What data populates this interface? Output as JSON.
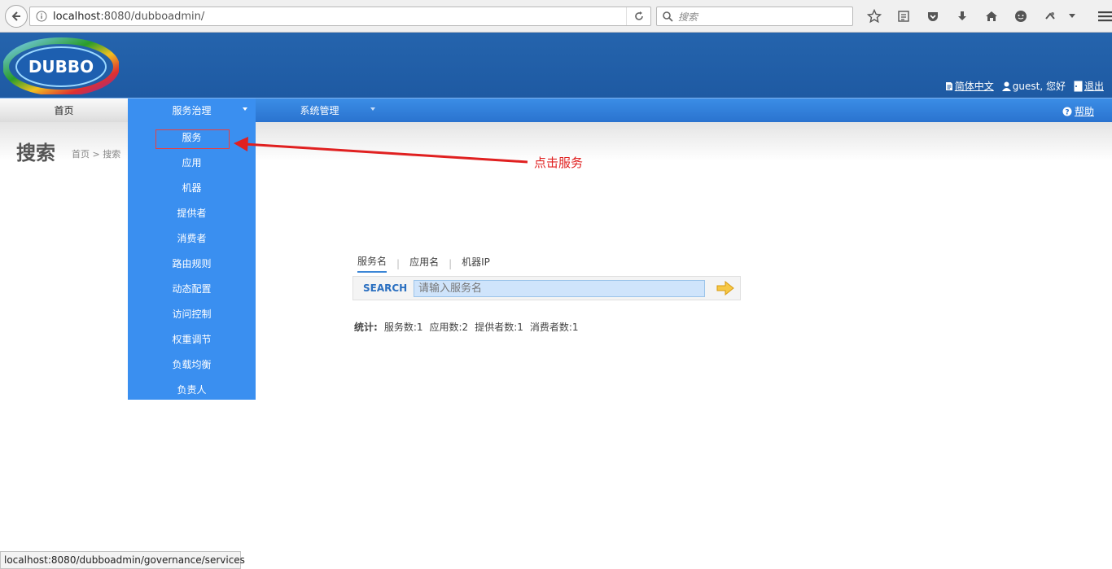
{
  "browser": {
    "url_host": "localhost",
    "url_rest": ":8080/dubboadmin/",
    "search_placeholder": "搜索"
  },
  "header": {
    "logo_text": "DUBBO",
    "language_link": "简体中文",
    "user_greeting": "guest, 您好",
    "logout_link": "退出"
  },
  "nav": {
    "home": "首页",
    "governance": "服务治理",
    "system": "系统管理",
    "help": "帮助"
  },
  "page": {
    "title": "搜索",
    "breadcrumb": "首页 > 搜索"
  },
  "dropdown": {
    "items": [
      "服务",
      "应用",
      "机器",
      "提供者",
      "消费者",
      "路由规则",
      "动态配置",
      "访问控制",
      "权重调节",
      "负载均衡",
      "负责人"
    ],
    "highlighted_index": 0
  },
  "annotation": {
    "text": "点击服务",
    "color": "#e02020"
  },
  "search": {
    "tabs": [
      "服务名",
      "应用名",
      "机器IP"
    ],
    "active_tab": 0,
    "label": "SEARCH",
    "placeholder": "请输入服务名"
  },
  "stats": {
    "label": "统计:",
    "services": "服务数:1",
    "apps": "应用数:2",
    "providers": "提供者数:1",
    "consumers": "消费者数:1"
  },
  "statusbar": {
    "link_url": "localhost:8080/dubboadmin/governance/services"
  },
  "colors": {
    "header_blue": "#1e5aa3",
    "menu_blue": "#3a8ff0",
    "search_label_blue": "#2a6fc0"
  }
}
